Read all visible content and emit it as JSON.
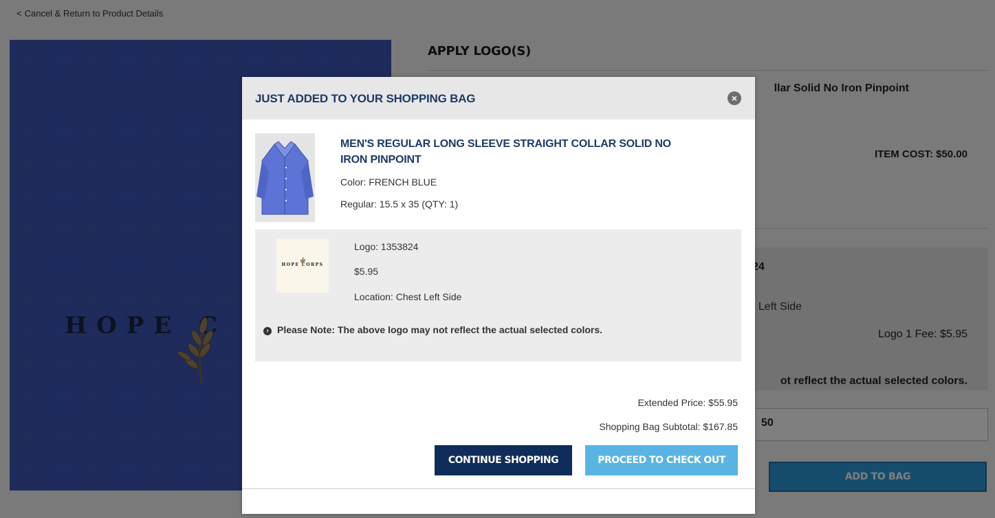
{
  "page": {
    "back_link": "Cancel & Return to Product Details",
    "section_title": "APPLY LOGO(S)",
    "product_name_partial": "llar Solid No Iron Pinpoint",
    "item_cost": "ITEM COST: $50.00",
    "logo_code_partial": "24",
    "logo_location_partial": "t Left Side",
    "logo_fee": "Logo 1 Fee: $5.95",
    "note_partial": "ot reflect the actual selected colors.",
    "total_partial": "50",
    "add_to_bag": "ADD TO BAG",
    "hero_logo_text": "HOPE  C"
  },
  "modal": {
    "title": "JUST ADDED TO YOUR SHOPPING BAG",
    "product": {
      "name": "MEN'S REGULAR LONG SLEEVE STRAIGHT COLLAR SOLID NO IRON PINPOINT",
      "color": "Color: FRENCH BLUE",
      "size": "Regular: 15.5 x 35 (QTY: 1)"
    },
    "logo": {
      "thumb_text": "HOPE CORPS",
      "code": "Logo: 1353824",
      "price": "$5.95",
      "location": "Location: Chest Left Side"
    },
    "note": "Please Note: The above logo may not reflect the actual selected colors.",
    "extended_price": "Extended Price: $55.95",
    "subtotal": "Shopping Bag Subtotal: $167.85",
    "buttons": {
      "continue": "CONTINUE SHOPPING",
      "checkout": "PROCEED TO CHECK OUT"
    }
  },
  "colors": {
    "navy": "#1e3a66",
    "continue_btn": "#0f2c5a",
    "checkout_btn": "#5ab4e3",
    "shirt_fabric": "#3b55b8"
  },
  "icons": {
    "back": "chevron-left-icon",
    "close": "close-icon",
    "note": "arrow-right-circle-icon"
  }
}
